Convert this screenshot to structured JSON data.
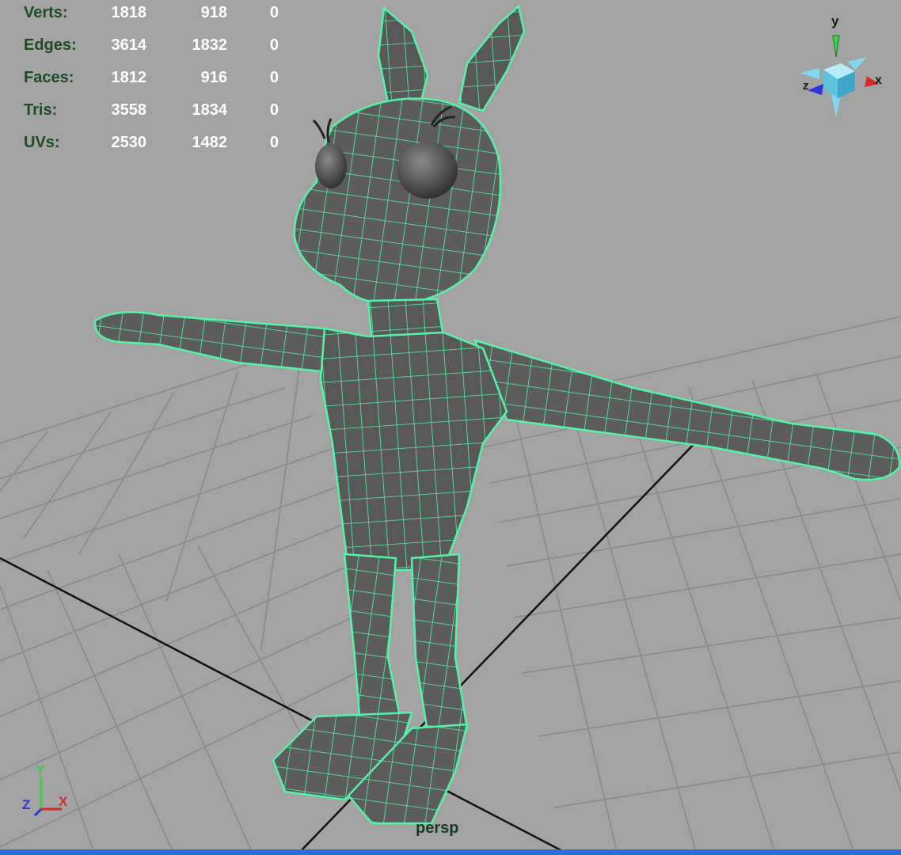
{
  "stats": [
    {
      "label": "Verts:",
      "total": "1818",
      "selected": "918",
      "third": "0"
    },
    {
      "label": "Edges:",
      "total": "3614",
      "selected": "1832",
      "third": "0"
    },
    {
      "label": "Faces:",
      "total": "1812",
      "selected": "916",
      "third": "0"
    },
    {
      "label": "Tris:",
      "total": "3558",
      "selected": "1834",
      "third": "0"
    },
    {
      "label": "UVs:",
      "total": "2530",
      "selected": "1482",
      "third": "0"
    }
  ],
  "camera": "persp",
  "view_cube": {
    "y": "y",
    "x": "x",
    "z": "z"
  },
  "axis_gizmo": {
    "y": "Y",
    "x": "X",
    "z": "Z"
  },
  "colors": {
    "background": "#a3a3a3",
    "grid": "#8c8c8c",
    "wireframe": "#55f2a8",
    "mesh": "#5e5e5e",
    "axis_x": "#e03a3a",
    "axis_y": "#3ad63a",
    "axis_z": "#2f3ad6"
  }
}
